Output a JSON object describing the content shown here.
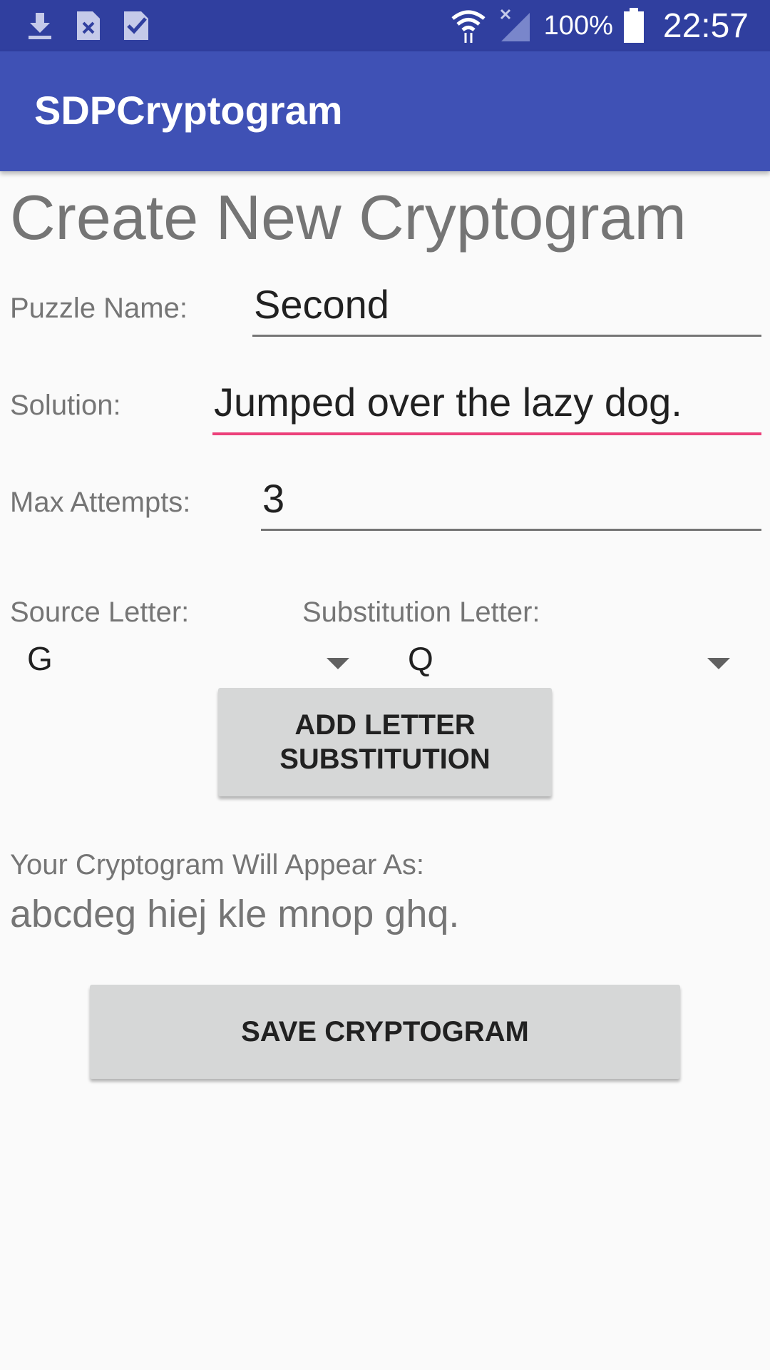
{
  "status_bar": {
    "left_icons": [
      "download-icon",
      "file-x-icon",
      "check-icon"
    ],
    "right_icons": [
      "wifi-icon",
      "no-signal-icon",
      "battery-icon"
    ],
    "battery": "100%",
    "time": "22:57"
  },
  "app_bar": {
    "title": "SDPCryptogram"
  },
  "page": {
    "title": "Create New Cryptogram"
  },
  "form": {
    "puzzle_name": {
      "label": "Puzzle Name:",
      "value": "Second"
    },
    "solution": {
      "label": "Solution:",
      "value": "Jumped over the lazy dog."
    },
    "max_attempts": {
      "label": "Max Attempts:",
      "value": "3"
    }
  },
  "substitution": {
    "source_label": "Source Letter:",
    "source_value": "G",
    "target_label": "Substitution Letter:",
    "target_value": "Q",
    "add_button": "ADD LETTER SUBSTITUTION"
  },
  "preview": {
    "label": "Your Cryptogram Will Appear As:",
    "text": "abcdeg hiej kle mnop ghq."
  },
  "actions": {
    "save_button": "SAVE CRYPTOGRAM"
  },
  "colors": {
    "status_bar": "#303f9f",
    "app_bar": "#3f51b5",
    "accent": "#ec407a"
  }
}
